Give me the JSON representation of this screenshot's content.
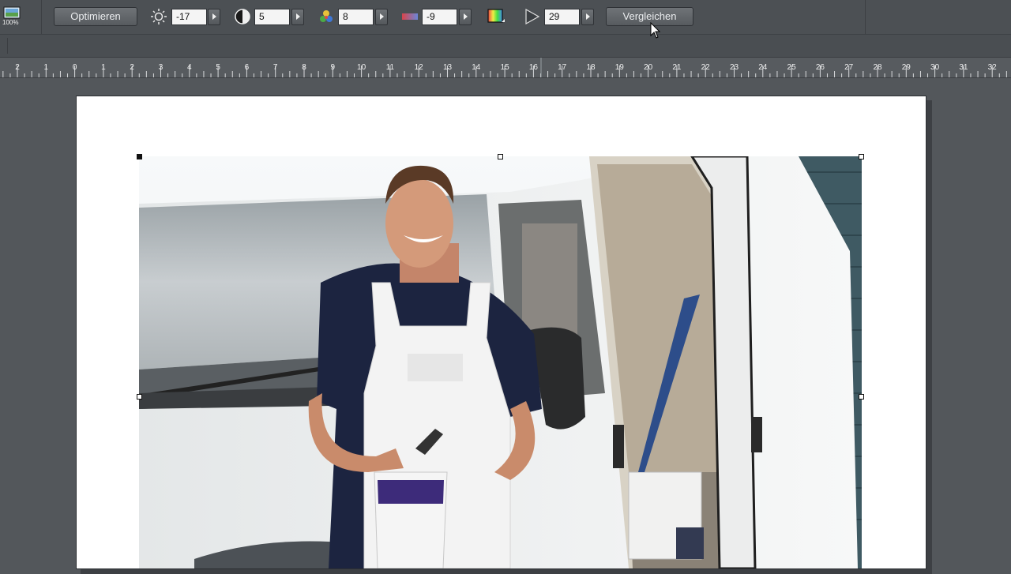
{
  "toolbar": {
    "zoom_label": "100%",
    "optimize_label": "Optimieren",
    "brightness_value": "-17",
    "contrast_value": "5",
    "saturation_value": "8",
    "color_value": "-9",
    "sharpness_value": "29",
    "compare_label": "Vergleichen"
  },
  "ruler": {
    "labels": [
      "2",
      "1",
      "0",
      "1",
      "2",
      "3",
      "4",
      "5",
      "6",
      "7",
      "8",
      "9",
      "10",
      "11",
      "12",
      "13",
      "14",
      "15",
      "16",
      "17",
      "18",
      "19",
      "20",
      "21",
      "22",
      "23",
      "24",
      "25",
      "26",
      "27",
      "28",
      "29",
      "30",
      "31",
      "32"
    ]
  },
  "colors": {
    "toolbar_bg": "#4c5054",
    "workspace_bg": "#53575b",
    "page_bg": "#ffffff",
    "field_bg": "#f4f4f4"
  },
  "icons": {
    "zoom": "image-zoom-icon",
    "brightness": "sun-icon",
    "contrast": "half-circle-icon",
    "saturation": "color-dots-icon",
    "color": "color-bar-icon",
    "gradient": "gradient-square-icon",
    "sharpness": "play-triangle-icon"
  }
}
